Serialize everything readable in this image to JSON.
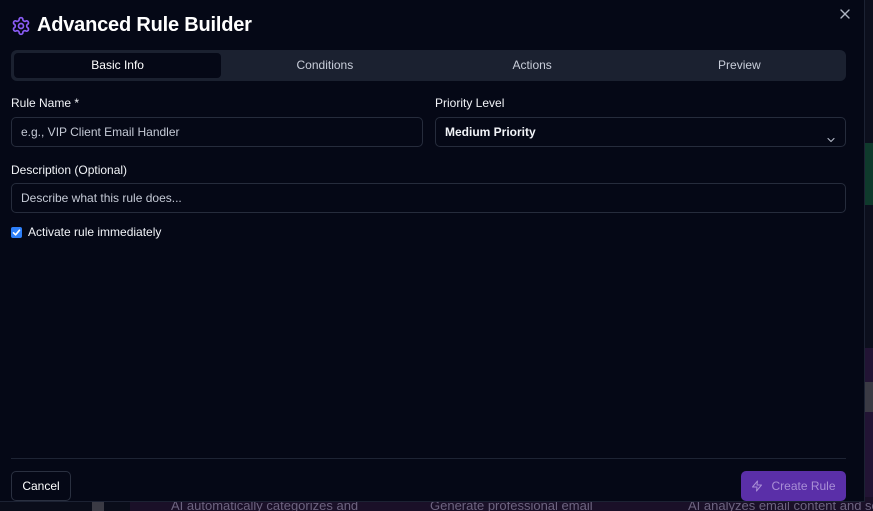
{
  "modal": {
    "title": "Advanced Rule Builder",
    "icon": "gear-icon",
    "accent_color": "#8b5cf6"
  },
  "tabs": [
    {
      "label": "Basic Info",
      "active": true
    },
    {
      "label": "Conditions",
      "active": false
    },
    {
      "label": "Actions",
      "active": false
    },
    {
      "label": "Preview",
      "active": false
    }
  ],
  "form": {
    "rule_name_label": "Rule Name *",
    "rule_name_placeholder": "e.g., VIP Client Email Handler",
    "rule_name_value": "",
    "priority_label": "Priority Level",
    "priority_value": "Medium Priority",
    "description_label": "Description (Optional)",
    "description_placeholder": "Describe what this rule does...",
    "description_value": "",
    "activate_label": "Activate rule immediately",
    "activate_checked": true
  },
  "footer": {
    "cancel_label": "Cancel",
    "create_label": "Create Rule",
    "create_color": "#5a2fa8"
  },
  "background": {
    "texts": [
      "AI automatically categorizes and",
      "Generate professional email",
      "AI analyzes email content and se"
    ]
  }
}
